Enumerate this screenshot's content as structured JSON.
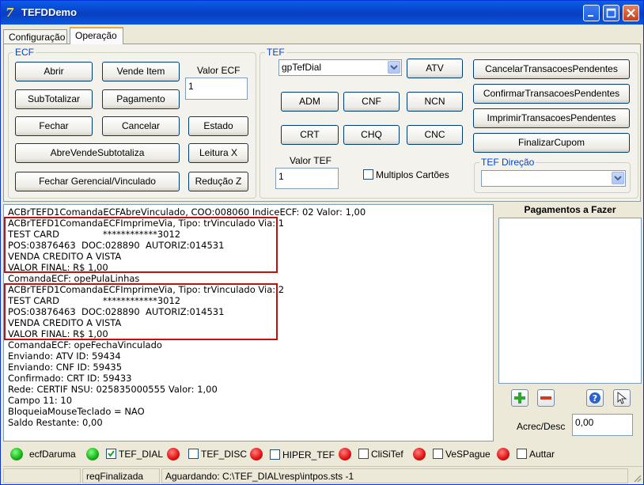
{
  "window": {
    "title": "TEFDDemo"
  },
  "tabs": [
    {
      "label": "Configuração"
    },
    {
      "label": "Operação"
    }
  ],
  "ecf": {
    "group_label": "ECF",
    "buttons": {
      "abrir": "Abrir",
      "vende_item": "Vende Item",
      "subtotalizar": "SubTotalizar",
      "pagamento": "Pagamento",
      "fechar": "Fechar",
      "cancelar": "Cancelar",
      "estado": "Estado",
      "abre_vende_subtotaliza": "AbreVendeSubtotaliza",
      "leitura_x": "Leitura X",
      "fechar_gerencial": "Fechar Gerencial/Vinculado",
      "reducao_z": "Redução Z"
    },
    "valor_label": "Valor ECF",
    "valor_value": "1"
  },
  "tef": {
    "group_label": "TEF",
    "gp_select": "gpTefDial",
    "buttons": {
      "atv": "ATV",
      "adm": "ADM",
      "cnf": "CNF",
      "ncn": "NCN",
      "crt": "CRT",
      "chq": "CHQ",
      "cnc": "CNC"
    },
    "side_buttons": {
      "cancelar": "CancelarTransacoesPendentes",
      "confirmar": "ConfirmarTransacoesPendentes",
      "imprimir": "ImprimirTransacoesPendentes",
      "finalizar": "FinalizarCupom"
    },
    "valor_label": "Valor TEF",
    "valor_value": "1",
    "multiplos_label": "Multiplos Cartões",
    "direcao_label": "TEF Direção",
    "direcao_value": ""
  },
  "log": {
    "lines": [
      "ACBrTEFD1ComandaECFAbreVinculado, COO:008060 IndiceECF: 02 Valor: 1,00",
      "ACBrTEFD1ComandaECFImprimeVia, Tipo: trVinculado Via: 1",
      "TEST CARD               ************3012",
      "POS:03876463  DOC:028890  AUTORIZ:014531",
      "VENDA CREDITO A VISTA",
      "VALOR FINAL: R$ 1,00",
      "ComandaECF: opePulaLinhas",
      "ACBrTEFD1ComandaECFImprimeVia, Tipo: trVinculado Via: 2",
      "TEST CARD               ************3012",
      "POS:03876463  DOC:028890  AUTORIZ:014531",
      "VENDA CREDITO A VISTA",
      "VALOR FINAL: R$ 1,00",
      "ComandaECF: opeFechaVinculado",
      "Enviando: ATV ID: 59434",
      "Enviando: CNF ID: 59435",
      "Confirmado: CRT ID: 59433",
      "Rede: CERTIF NSU: 025835000555 Valor: 1,00",
      "Campo 11: 10",
      "BloqueiaMouseTeclado = NAO",
      "Saldo Restante: 0,00"
    ]
  },
  "pagamentos": {
    "title": "Pagamentos a Fazer",
    "acrec_label": "Acrec/Desc",
    "acrec_value": "0,00"
  },
  "status": {
    "items": [
      {
        "label": "ecfDaruma",
        "color": "#16b016",
        "checkbox": false,
        "checked": false
      },
      {
        "label": "TEF_DIAL",
        "color": "#16b016",
        "checkbox": true,
        "checked": true
      },
      {
        "label": "TEF_DISC",
        "color": "#e01010",
        "checkbox": true,
        "checked": false
      },
      {
        "label": "HIPER_TEF",
        "color": "#e01010",
        "checkbox": true,
        "checked": false
      },
      {
        "label": "CliSiTef",
        "color": "#e01010",
        "checkbox": true,
        "checked": false
      },
      {
        "label": "VeSPague",
        "color": "#e01010",
        "checkbox": true,
        "checked": false
      },
      {
        "label": "Auttar",
        "color": "#e01010",
        "checkbox": true,
        "checked": false
      }
    ]
  },
  "statusbar": {
    "p1": "",
    "p2": "reqFinalizada",
    "p3": "Aguardando: C:\\TEF_DIAL\\resp\\intpos.sts -1"
  }
}
